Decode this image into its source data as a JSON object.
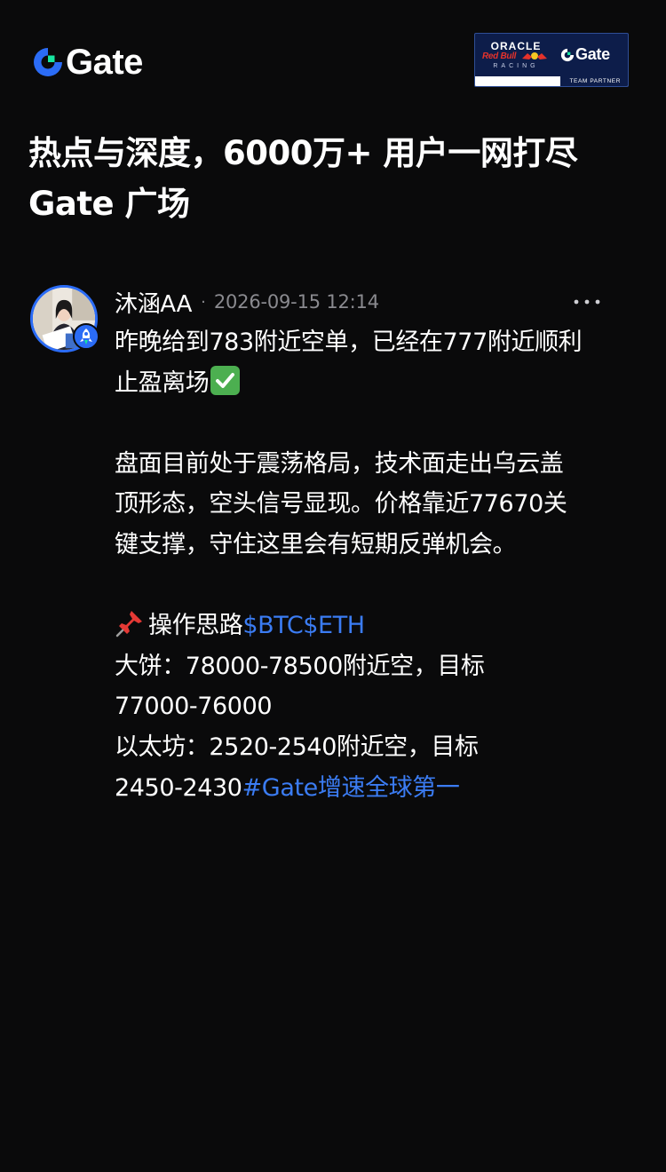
{
  "header": {
    "logo_text": "Gate",
    "partner_badge": {
      "oracle": "ORACLE",
      "red_bull": "Red Bull",
      "racing": "RACING",
      "gate": "Gate",
      "team_partner": "TEAM PARTNER"
    }
  },
  "headline": {
    "line1": "热点与深度，6000万+ 用户一网打尽",
    "line2": "Gate 广场"
  },
  "post": {
    "author": "沐涵AA",
    "separator": "·",
    "time": "2026-09-15 12:14",
    "more_icon": "more-dots-icon",
    "body": {
      "line1": "昨晚给到783附近空单，已经在777附近顺利",
      "line2": "止盈离场",
      "line3": "盘面目前处于震荡格局，技术面走出乌云盖",
      "line4": "顶形态，空头信号显现。价格靠近77670关",
      "line5": "键支撑，守住这里会有短期反弹机会。",
      "line6_text": "操作思路",
      "tag_btc": "$BTC",
      "tag_eth": "$ETH",
      "line7": "大饼：78000-78500附近空，目标",
      "line8": "77000-76000",
      "line9": "以太坊：2520-2540附近空，目标",
      "line10_text": "2450-2430",
      "hashtag": "#Gate增速全球第一"
    }
  },
  "colors": {
    "background": "#0a0a0b",
    "link": "#3b7cf3",
    "muted": "#8a8a8f",
    "brand_blue": "#2b6cf6",
    "brand_green": "#17e6a1"
  }
}
